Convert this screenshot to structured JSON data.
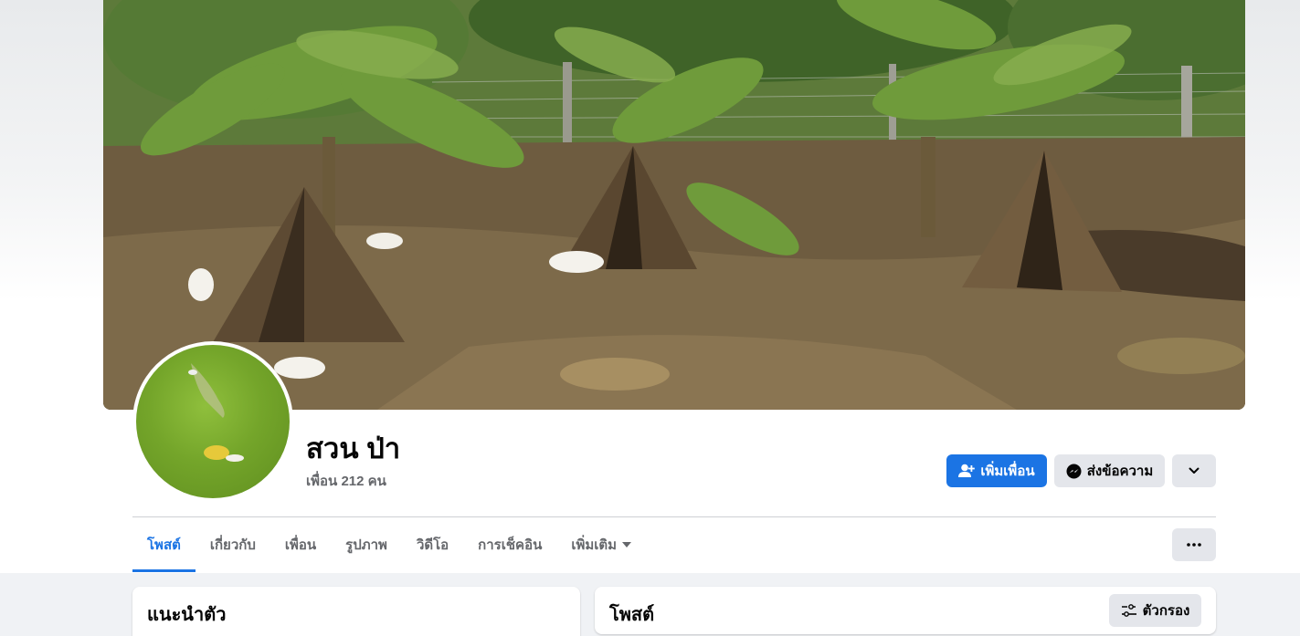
{
  "profile": {
    "name": "สวน ป่า",
    "friends_count": "เพื่อน 212 คน"
  },
  "actions": {
    "add_friend": "เพิ่มเพื่อน",
    "message": "ส่งข้อความ"
  },
  "tabs": [
    {
      "label": "โพสต์",
      "active": true
    },
    {
      "label": "เกี่ยวกับ"
    },
    {
      "label": "เพื่อน"
    },
    {
      "label": "รูปภาพ"
    },
    {
      "label": "วิดีโอ"
    },
    {
      "label": "การเช็คอิน"
    },
    {
      "label": "เพิ่มเติม"
    }
  ],
  "intro": {
    "title": "แนะนำตัว"
  },
  "posts": {
    "title": "โพสต์",
    "filter_label": "ตัวกรอง"
  },
  "colors": {
    "accent": "#1b74e4",
    "secondary_button": "#e4e6eb",
    "page_bg": "#f0f2f5"
  }
}
